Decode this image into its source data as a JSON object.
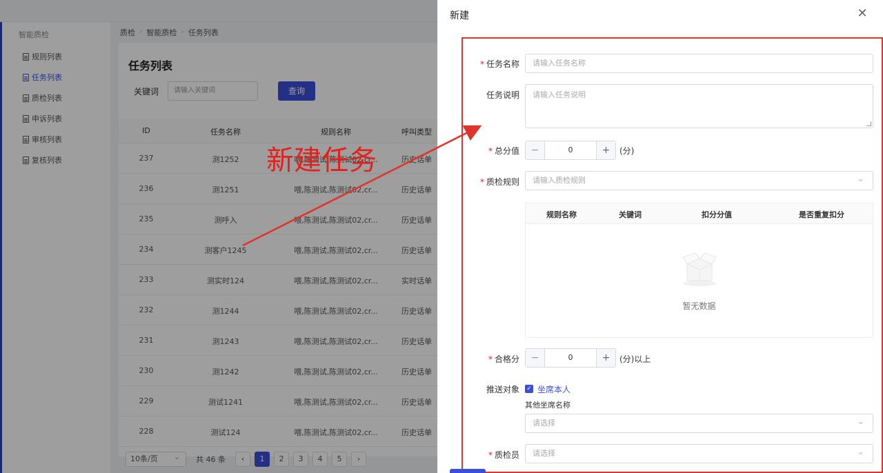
{
  "sidebar": {
    "title": "智能质检",
    "items": [
      {
        "label": "规则列表",
        "active": false
      },
      {
        "label": "任务列表",
        "active": true
      },
      {
        "label": "质检列表",
        "active": false
      },
      {
        "label": "申诉列表",
        "active": false
      },
      {
        "label": "审核列表",
        "active": false
      },
      {
        "label": "复核列表",
        "active": false
      }
    ]
  },
  "breadcrumb": [
    "质检",
    "智能质检",
    "任务列表"
  ],
  "page": {
    "title": "任务列表",
    "keyword_label": "关键词",
    "keyword_placeholder": "请输入关键词",
    "query_button": "查询"
  },
  "table": {
    "columns": [
      "ID",
      "任务名称",
      "规则名称",
      "呼叫类型"
    ],
    "rows": [
      {
        "id": "237",
        "name": "测1252",
        "rule": "喂,陈测试,陈测试02,cr...",
        "type": "历史话单"
      },
      {
        "id": "236",
        "name": "测1251",
        "rule": "喂,陈测试,陈测试02,cr...",
        "type": "历史话单"
      },
      {
        "id": "235",
        "name": "测呼入",
        "rule": "喂,陈测试,陈测试02,cr...",
        "type": "历史话单"
      },
      {
        "id": "234",
        "name": "测客户1245",
        "rule": "喂,陈测试,陈测试02,cr...",
        "type": "历史话单"
      },
      {
        "id": "233",
        "name": "测实时124",
        "rule": "喂,陈测试,陈测试02,cr...",
        "type": "实时话单"
      },
      {
        "id": "232",
        "name": "测1244",
        "rule": "喂,陈测试,陈测试02,cr...",
        "type": "历史话单"
      },
      {
        "id": "231",
        "name": "测1243",
        "rule": "喂,陈测试,陈测试02,cr...",
        "type": "历史话单"
      },
      {
        "id": "230",
        "name": "测1242",
        "rule": "喂,陈测试,陈测试02,cr...",
        "type": "历史话单"
      },
      {
        "id": "229",
        "name": "测试1241",
        "rule": "喂,陈测试,陈测试02,cr...",
        "type": "历史话单"
      },
      {
        "id": "228",
        "name": "测试124",
        "rule": "喂,陈测试,陈测试02,cr...",
        "type": "历史话单"
      }
    ]
  },
  "pager": {
    "page_size": "10条/页",
    "total": "共 46 条",
    "prev": "‹",
    "next": "›",
    "pages": [
      "1",
      "2",
      "3",
      "4",
      "5"
    ],
    "current": "1"
  },
  "annotation": {
    "text": "新建任务",
    "color": "#e3211c"
  },
  "drawer": {
    "title": "新建",
    "close_icon": "close-icon",
    "fields": {
      "task_name": {
        "label": "任务名称",
        "placeholder": "请输入任务名称"
      },
      "task_desc": {
        "label": "任务说明",
        "placeholder": "请输入任务说明"
      },
      "total_score": {
        "label": "总分值",
        "value": "0",
        "unit": "(分)"
      },
      "qc_rule": {
        "label": "质检规则",
        "placeholder": "请输入质检规则"
      },
      "pass_score": {
        "label": "合格分",
        "value": "0",
        "unit": "(分)以上"
      },
      "push_target": {
        "label": "推送对象",
        "checkbox_label": "坐席本人",
        "checked": true,
        "sub_label": "其他坐席名称",
        "placeholder": "请选择"
      },
      "inspector": {
        "label": "质检员",
        "placeholder": "请选择"
      }
    },
    "rule_table": {
      "columns": [
        "规则名称",
        "关键词",
        "扣分分值",
        "是否重复扣分"
      ],
      "empty_text": "暂无数据"
    },
    "stepper_minus": "−",
    "stepper_plus": "+"
  },
  "colors": {
    "primary": "#3b4ed8",
    "required": "#e3211c",
    "annotation": "#e0332c"
  }
}
